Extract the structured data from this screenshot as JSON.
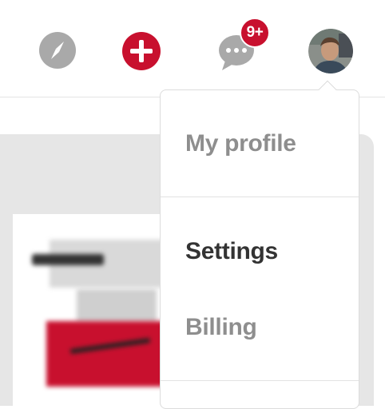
{
  "topbar": {
    "icons": {
      "explore": "compass-icon",
      "create": "plus-icon",
      "messages": "chat-bubble-icon",
      "profile": "avatar"
    },
    "notification_badge": "9+"
  },
  "menu": {
    "items": [
      {
        "label": "My profile",
        "state": "muted"
      },
      {
        "label": "Settings",
        "state": "active"
      },
      {
        "label": "Billing",
        "state": "muted"
      }
    ]
  },
  "colors": {
    "brand_red": "#c8102e",
    "icon_gray": "#a9a9a9",
    "text_active": "#333333",
    "text_muted": "#8e8e8e"
  }
}
